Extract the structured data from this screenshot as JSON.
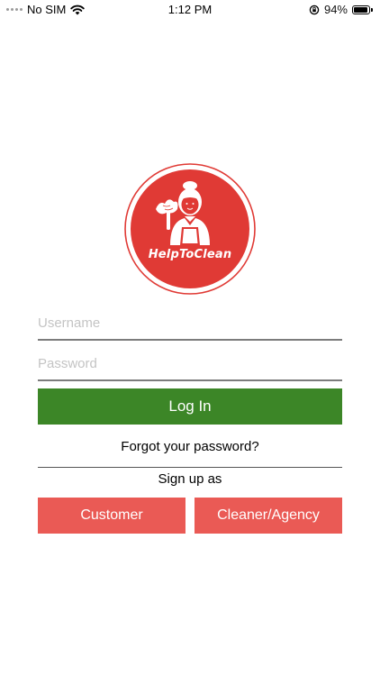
{
  "status_bar": {
    "carrier": "No SIM",
    "time": "1:12 PM",
    "battery_percent": "94%",
    "battery_level": 0.94
  },
  "logo": {
    "text": "HelpToClean",
    "color": "#e03a35"
  },
  "login_form": {
    "username_placeholder": "Username",
    "password_placeholder": "Password",
    "login_label": "Log In",
    "forgot_label": "Forgot your password?"
  },
  "signup": {
    "label": "Sign up as",
    "customer_label": "Customer",
    "cleaner_label": "Cleaner/Agency"
  },
  "colors": {
    "login_button": "#3c8627",
    "role_buttons": "#ea5a55"
  }
}
